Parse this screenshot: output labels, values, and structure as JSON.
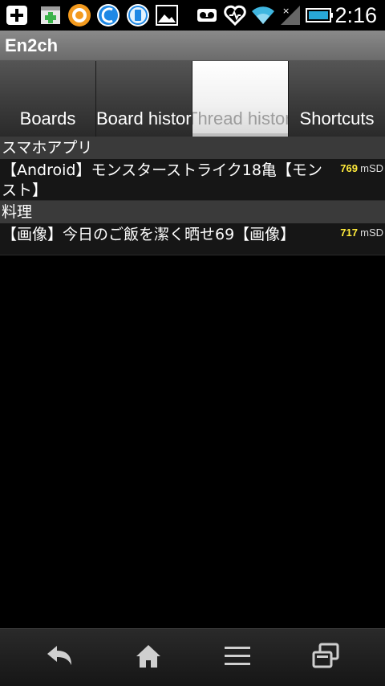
{
  "status_bar": {
    "time": "2:16",
    "icons": [
      "usb-debug-icon",
      "sd-card-icon",
      "orange-app-icon",
      "blue-app-icon",
      "battery-widget-icon",
      "gallery-icon",
      "voicemail-icon",
      "health-app-icon",
      "wifi-icon",
      "signal-icon",
      "battery-icon"
    ]
  },
  "app": {
    "title": "En2ch"
  },
  "tabs": [
    {
      "label": "Boards",
      "selected": false
    },
    {
      "label": "Board histor",
      "selected": false
    },
    {
      "label": "Thread histor",
      "selected": true
    },
    {
      "label": "Shortcuts",
      "selected": false
    }
  ],
  "groups": [
    {
      "header": "スマホアプリ",
      "threads": [
        {
          "title": "【Android】モンスターストライク18亀【モンスト】",
          "count": "769",
          "board": "mSD"
        }
      ]
    },
    {
      "header": "料理",
      "threads": [
        {
          "title": "【画像】今日のご飯を潔く晒せ69【画像】",
          "count": "717",
          "board": "mSD"
        }
      ]
    }
  ],
  "nav": {
    "icons": [
      "back-icon",
      "home-icon",
      "menu-icon",
      "recent-apps-icon"
    ]
  },
  "colors": {
    "count_color": "#ffeb3b",
    "header_bg": "#3a3a3a",
    "row_bg": "#161616"
  }
}
